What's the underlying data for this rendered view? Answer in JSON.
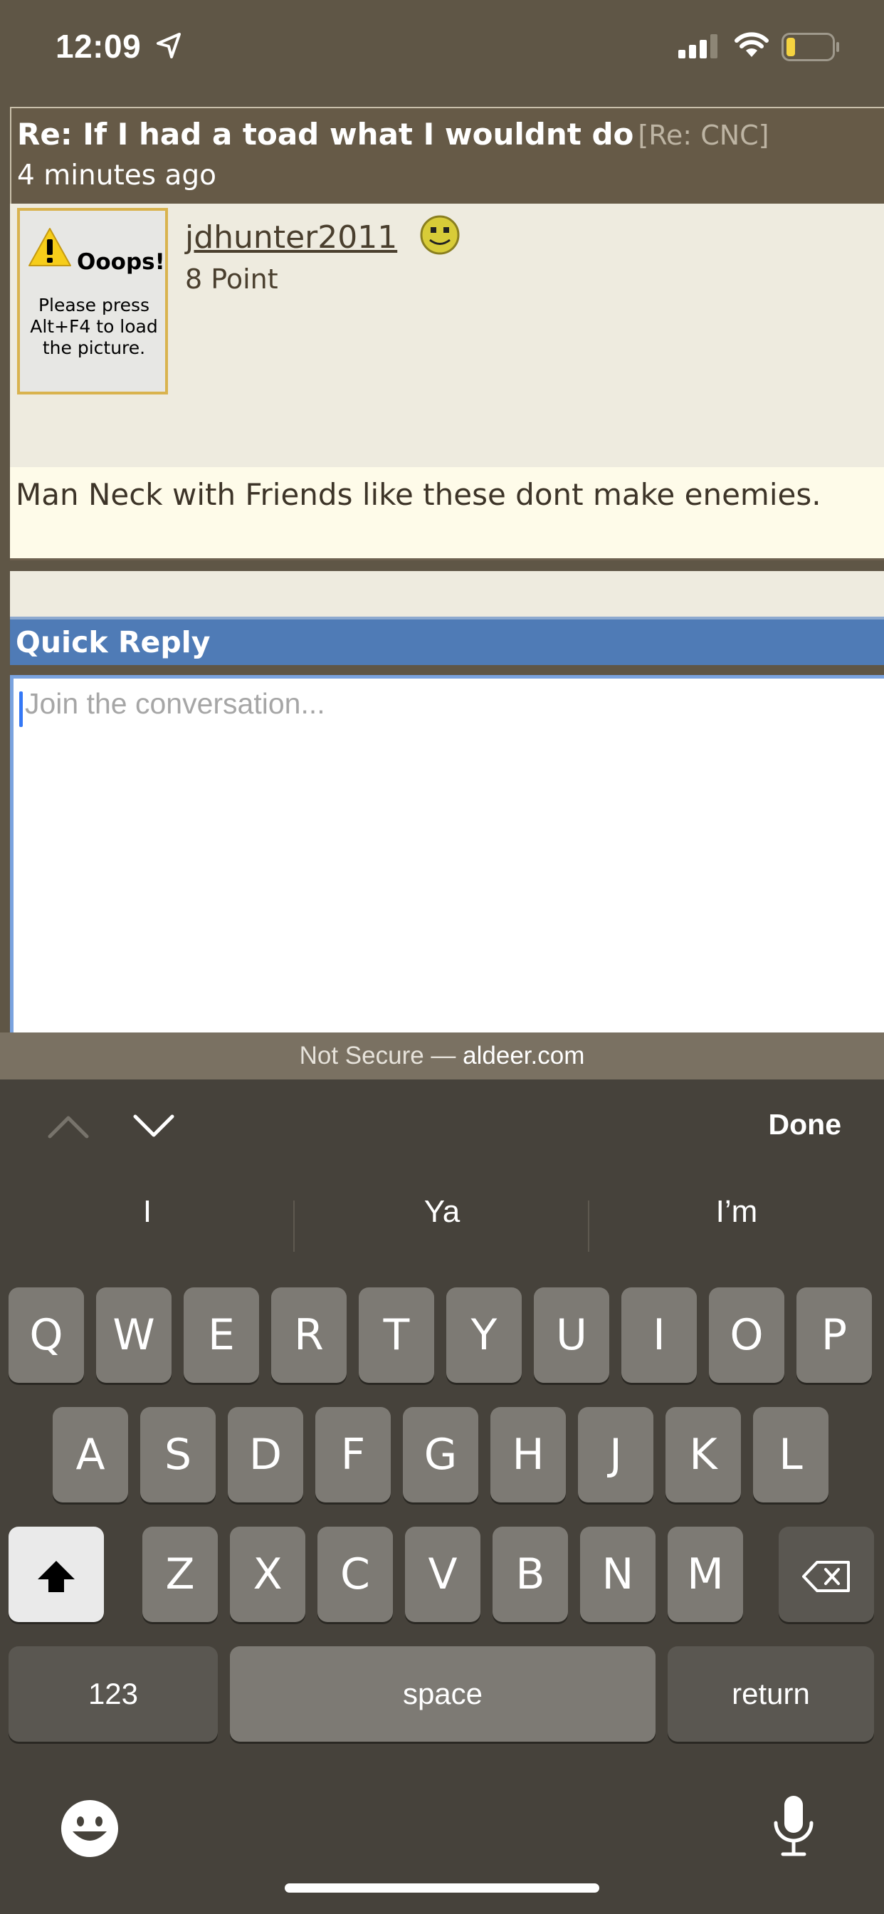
{
  "status_bar": {
    "time": "12:09"
  },
  "post": {
    "title": "Re: If I had a toad what I wouldnt do",
    "tag": "[Re: CNC]",
    "time": "4 minutes ago",
    "avatar": {
      "heading": "Ooops!",
      "message": "Please press Alt+F4 to load the picture."
    },
    "username": "jdhunter2011",
    "points": "8 Point",
    "body": "Man Neck with Friends like these dont make enemies."
  },
  "quick_reply": {
    "title": "Quick Reply",
    "placeholder": "Join the conversation..."
  },
  "url_bar": {
    "prefix": "Not Secure — ",
    "domain": "aldeer.com"
  },
  "keyboard": {
    "done_label": "Done",
    "predictions": [
      "I",
      "Ya",
      "I’m"
    ],
    "row1": [
      "Q",
      "W",
      "E",
      "R",
      "T",
      "Y",
      "U",
      "I",
      "O",
      "P"
    ],
    "row2": [
      "A",
      "S",
      "D",
      "F",
      "G",
      "H",
      "J",
      "K",
      "L"
    ],
    "row3": [
      "Z",
      "X",
      "C",
      "V",
      "B",
      "N",
      "M"
    ],
    "numbers_label": "123",
    "space_label": "space",
    "return_label": "return"
  },
  "colors": {
    "background": "#5f5646",
    "quick_reply_header": "#4f7bb6",
    "keyboard": "#46423b",
    "avatar_border": "#d9b34e"
  }
}
